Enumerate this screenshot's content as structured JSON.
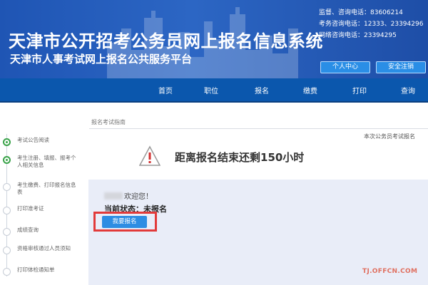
{
  "header": {
    "title": "天津市公开招考公务员网上报名信息系统",
    "subtitle": "天津市人事考试网上报名公共服务平台",
    "contact_lines": [
      "监督、咨询电话：83606214",
      "考务咨询电话：12333、23394296",
      "网络咨询电话：23394295"
    ],
    "user_center_label": "个人中心",
    "register_label": "安全注销"
  },
  "nav": {
    "items": [
      "首页",
      "职位",
      "报名",
      "缴费",
      "打印",
      "查询"
    ]
  },
  "sidebar": {
    "steps": [
      {
        "label": "考试公告阅读",
        "state": "done"
      },
      {
        "label": "考生注册、填报、报考个人相关信息",
        "state": "done"
      },
      {
        "label": "考生缴费、打印报名信息表",
        "state": "pending"
      },
      {
        "label": "打印准考证",
        "state": "pending"
      },
      {
        "label": "成绩查询",
        "state": "pending"
      },
      {
        "label": "资格审核通过人员须知",
        "state": "pending"
      },
      {
        "label": "打印体检通知单",
        "state": "pending"
      }
    ]
  },
  "main": {
    "breadcrumb": "报名考试指南",
    "right_link": "本次公务员考试报名",
    "countdown": "距离报名结束还剩150小时",
    "welcome": "欢迎您！",
    "status": "当前状态：未报名",
    "apply_button": "我要报名",
    "watermark": "TJ.OFFCN.COM"
  },
  "colors": {
    "header_blue": "#1f55b4",
    "nav_blue": "#0b57ad",
    "button_blue": "#2d8de3",
    "highlight_red": "#e23a3a",
    "panel_bg": "#e9edf8",
    "step_done_green": "#3aa34a"
  }
}
